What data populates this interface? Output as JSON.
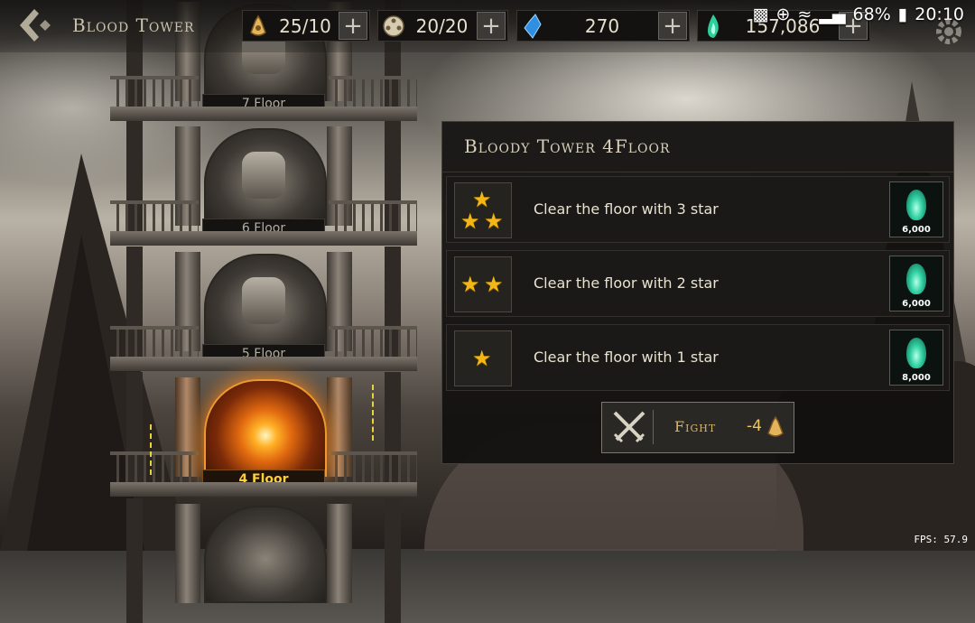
{
  "header": {
    "title": "Blood Tower",
    "back_icon": "back-arrow-icon"
  },
  "resources": [
    {
      "name": "stamina",
      "icon": "horn-icon",
      "value": "25/10"
    },
    {
      "name": "tickets",
      "icon": "film-reel-icon",
      "value": "20/20"
    },
    {
      "name": "blue-crystal",
      "icon": "blue-crystal-icon",
      "value": "270"
    },
    {
      "name": "green-soul",
      "icon": "green-flame-icon",
      "value": "157,086"
    }
  ],
  "status_bar": {
    "battery": "68%",
    "time": "20:10"
  },
  "tower": {
    "floors": [
      {
        "label": "7 Floor"
      },
      {
        "label": "6 Floor"
      },
      {
        "label": "5 Floor"
      },
      {
        "label": "4 Floor",
        "active": true
      }
    ]
  },
  "panel": {
    "title": "Bloody Tower 4Floor",
    "missions": [
      {
        "stars": 3,
        "text": "Clear the floor with 3 star",
        "reward": "6,000"
      },
      {
        "stars": 2,
        "text": "Clear the floor with 2 star",
        "reward": "6,000"
      },
      {
        "stars": 1,
        "text": "Clear the floor with 1 star",
        "reward": "8,000"
      }
    ],
    "fight": {
      "label": "Fight",
      "cost": "-4"
    }
  },
  "fps": "FPS: 57.9",
  "colors": {
    "star": "#f3b614",
    "active_floor": "#ffcf36",
    "reward_gem": "#32d2a4",
    "fight_text": "#d9b46a"
  }
}
